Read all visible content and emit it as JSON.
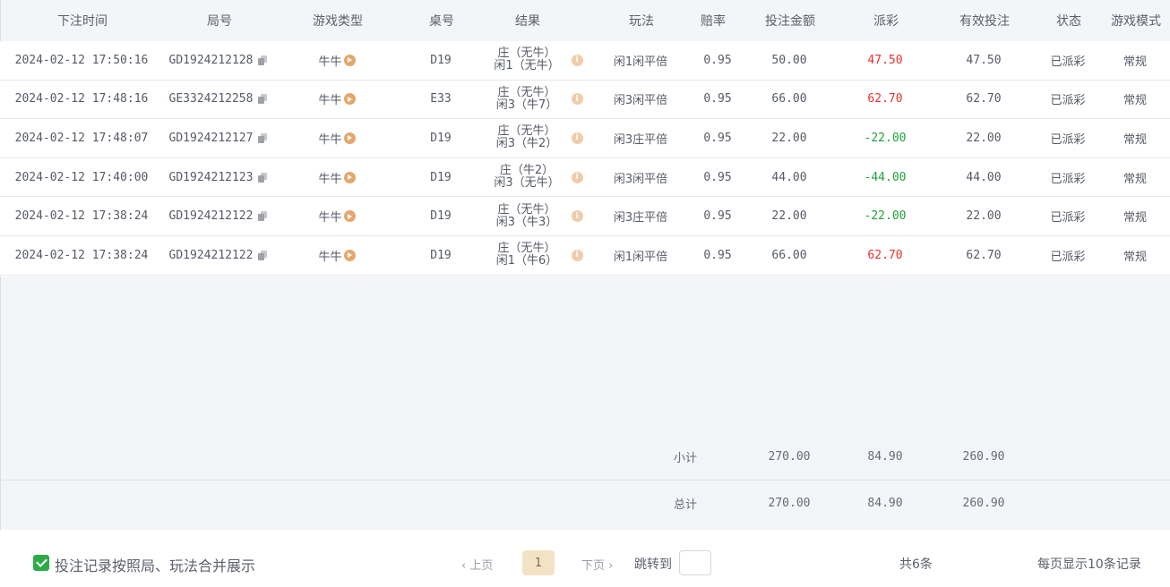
{
  "columns": {
    "time": "下注时间",
    "round_id": "局号",
    "game_type": "游戏类型",
    "table": "桌号",
    "result": "结果",
    "play": "玩法",
    "odds": "赔率",
    "bet_amount": "投注金额",
    "payout": "派彩",
    "valid_bet": "有效投注",
    "status": "状态",
    "game_mode": "游戏模式"
  },
  "rows": [
    {
      "time": "2024-02-12 17:50:16",
      "round_id": "GD1924212128",
      "game_type": "牛牛",
      "table": "D19",
      "result_line1": "庄（无牛）",
      "result_line2": "闲1（无牛）",
      "play": "闲1闲平倍",
      "odds": "0.95",
      "bet_amount": "50.00",
      "payout": "47.50",
      "payout_sign": "positive",
      "valid_bet": "47.50",
      "status": "已派彩",
      "game_mode": "常规"
    },
    {
      "time": "2024-02-12 17:48:16",
      "round_id": "GE3324212258",
      "game_type": "牛牛",
      "table": "E33",
      "result_line1": "庄（无牛）",
      "result_line2": "闲3（牛7）",
      "play": "闲3闲平倍",
      "odds": "0.95",
      "bet_amount": "66.00",
      "payout": "62.70",
      "payout_sign": "positive",
      "valid_bet": "62.70",
      "status": "已派彩",
      "game_mode": "常规"
    },
    {
      "time": "2024-02-12 17:48:07",
      "round_id": "GD1924212127",
      "game_type": "牛牛",
      "table": "D19",
      "result_line1": "庄（无牛）",
      "result_line2": "闲3（牛2）",
      "play": "闲3庄平倍",
      "odds": "0.95",
      "bet_amount": "22.00",
      "payout": "-22.00",
      "payout_sign": "negative",
      "valid_bet": "22.00",
      "status": "已派彩",
      "game_mode": "常规"
    },
    {
      "time": "2024-02-12 17:40:00",
      "round_id": "GD1924212123",
      "game_type": "牛牛",
      "table": "D19",
      "result_line1": "庄（牛2）",
      "result_line2": "闲3（无牛）",
      "play": "闲3闲平倍",
      "odds": "0.95",
      "bet_amount": "44.00",
      "payout": "-44.00",
      "payout_sign": "negative",
      "valid_bet": "44.00",
      "status": "已派彩",
      "game_mode": "常规"
    },
    {
      "time": "2024-02-12 17:38:24",
      "round_id": "GD1924212122",
      "game_type": "牛牛",
      "table": "D19",
      "result_line1": "庄（无牛）",
      "result_line2": "闲3（牛3）",
      "play": "闲3庄平倍",
      "odds": "0.95",
      "bet_amount": "22.00",
      "payout": "-22.00",
      "payout_sign": "negative",
      "valid_bet": "22.00",
      "status": "已派彩",
      "game_mode": "常规"
    },
    {
      "time": "2024-02-12 17:38:24",
      "round_id": "GD1924212122",
      "game_type": "牛牛",
      "table": "D19",
      "result_line1": "庄（无牛）",
      "result_line2": "闲1（牛6）",
      "play": "闲1闲平倍",
      "odds": "0.95",
      "bet_amount": "66.00",
      "payout": "62.70",
      "payout_sign": "positive",
      "valid_bet": "62.70",
      "status": "已派彩",
      "game_mode": "常规"
    }
  ],
  "subtotal": {
    "label": "小计",
    "bet_amount": "270.00",
    "payout": "84.90",
    "valid_bet": "260.90"
  },
  "total": {
    "label": "总计",
    "bet_amount": "270.00",
    "payout": "84.90",
    "valid_bet": "260.90"
  },
  "footer": {
    "merge_checkbox_checked": true,
    "merge_label": "投注记录按照局、玩法合并展示",
    "prev_label": "‹ 上页",
    "current_page": "1",
    "next_label": "下页 ›",
    "jump_label": "跳转到",
    "jump_value": "",
    "total_count": "共6条",
    "per_page": "每页显示10条记录"
  },
  "colors": {
    "positive_payout": "#e5322d",
    "negative_payout": "#1fa33a",
    "header_bg": "#f4f5f9",
    "checkbox": "#2eaa49",
    "active_page_bg": "#f3e3c6"
  },
  "icons": {
    "round_id": "copy-icon",
    "game_type": "play-circle-icon",
    "result": "info-icon"
  }
}
